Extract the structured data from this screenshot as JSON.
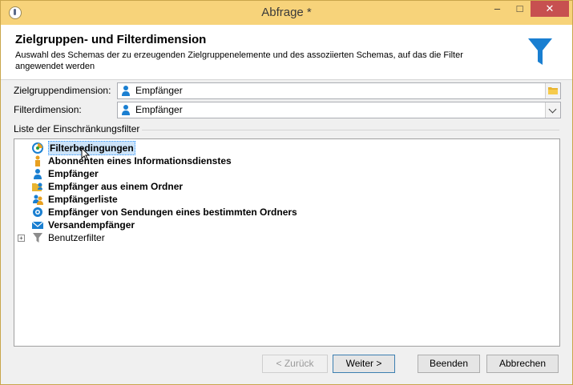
{
  "window": {
    "title": "Abfrage *",
    "controls": {
      "minimize": "–",
      "maximize": "□",
      "close": "✕"
    }
  },
  "header": {
    "title": "Zielgruppen- und Filterdimension",
    "description": "Auswahl des Schemas der zu erzeugenden Zielgruppenelemente und des assoziierten Schemas, auf das die Filter angewendet werden",
    "icon": "funnel-icon"
  },
  "form": {
    "target_label": "Zielgruppendimension:",
    "target_value": "Empfänger",
    "filter_label": "Filterdimension:",
    "filter_value": "Empfänger"
  },
  "tree": {
    "group_label": "Liste der Einschränkungsfilter",
    "items": [
      {
        "label": "Filterbedingungen",
        "icon": "filter-conditions-icon",
        "selected": true
      },
      {
        "label": "Abonnenten eines Informationsdienstes",
        "icon": "subscriber-icon"
      },
      {
        "label": "Empfänger",
        "icon": "recipient-icon"
      },
      {
        "label": "Empfänger aus einem Ordner",
        "icon": "recipient-folder-icon"
      },
      {
        "label": "Empfängerliste",
        "icon": "recipient-list-icon"
      },
      {
        "label": "Empfänger von Sendungen eines bestimmten Ordners",
        "icon": "delivery-recipients-icon"
      },
      {
        "label": "Versandempfänger",
        "icon": "envelope-icon"
      },
      {
        "label": "Benutzerfilter",
        "icon": "user-filter-icon",
        "expandable": true,
        "expander": "+"
      }
    ]
  },
  "buttons": {
    "back": "< Zurück",
    "next": "Weiter >",
    "finish": "Beenden",
    "cancel": "Abbrechen"
  },
  "colors": {
    "titlebar": "#f7d37a",
    "close": "#c75050",
    "accent": "#1a7fd1",
    "selection": "#cce3f8"
  }
}
